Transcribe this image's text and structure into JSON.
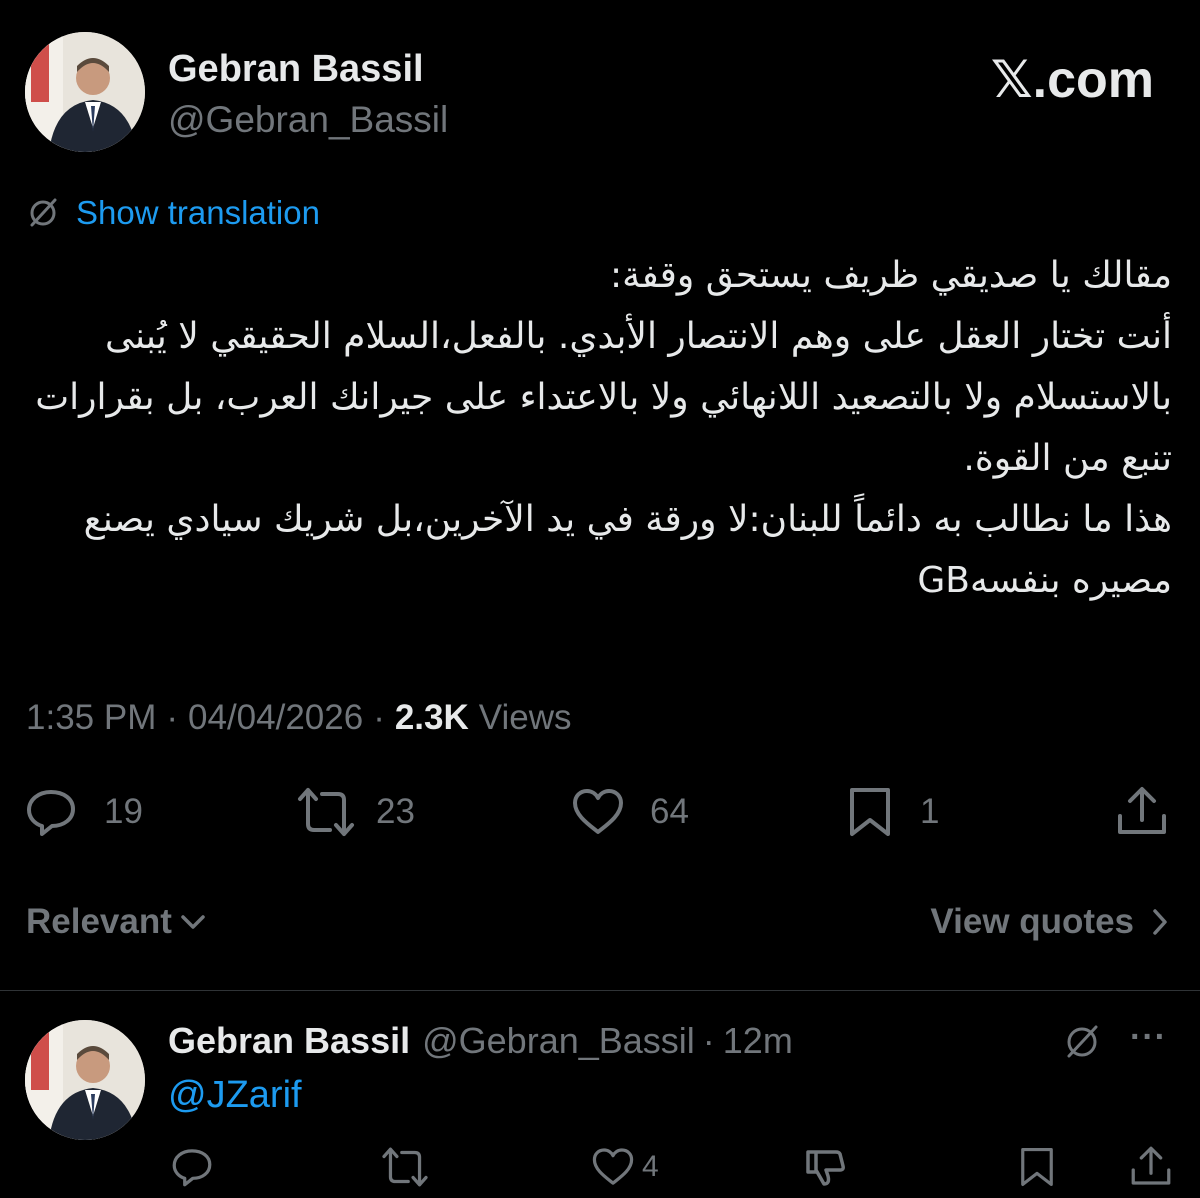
{
  "header": {
    "display_name": "Gebran Bassil",
    "handle": "@Gebran_Bassil",
    "site_logo_text": "𝕏.com"
  },
  "translation": {
    "icon": "no-translate-icon",
    "label": "Show translation"
  },
  "tweet": {
    "text": "مقالك يا صديقي ظريف يستحق وقفة:\nأنت تختار العقل على وهم الانتصار الأبدي. بالفعل،السلام الحقيقي لا يُبنى بالاستسلام ولا بالتصعيد اللانهائي ولا بالاعتداء على جيرانك العرب، بل بقرارات تنبع من القوة.\nهذا ما نطالب به دائماً للبنان:لا ورقة في يد الآخرين،بل شريك سيادي يصنع مصيره بنفسهGB"
  },
  "meta": {
    "time": "1:35 PM",
    "separator": "·",
    "date": "04/04/2026",
    "views_count": "2.3K",
    "views_label": "Views"
  },
  "actions": {
    "replies": "19",
    "reposts": "23",
    "likes": "64",
    "bookmarks": "1"
  },
  "filters": {
    "sort_label": "Relevant",
    "view_quotes_label": "View quotes"
  },
  "reply": {
    "display_name": "Gebran Bassil",
    "handle": "@Gebran_Bassil",
    "separator": "·",
    "time": "12m",
    "more": "···",
    "mention": "@JZarif",
    "likes": "4"
  },
  "colors": {
    "background": "#000000",
    "text": "#e7e9ea",
    "muted": "#71767b",
    "link": "#1d9bf0",
    "divider": "#2f3336"
  }
}
